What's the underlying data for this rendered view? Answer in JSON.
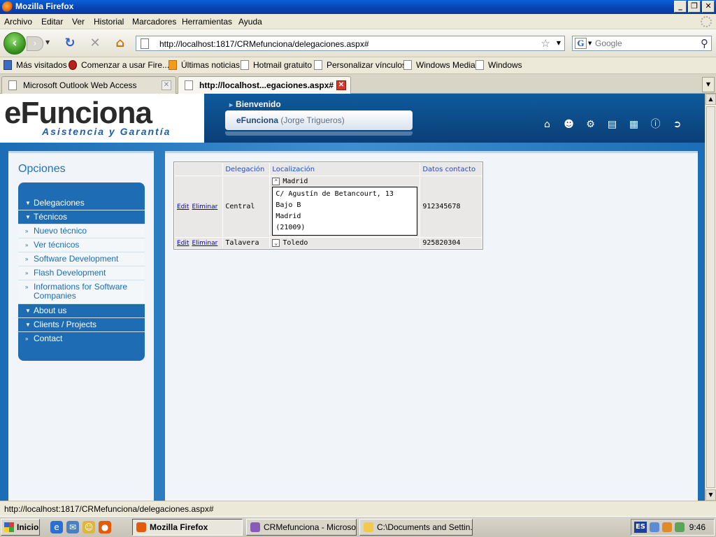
{
  "window": {
    "title": "Mozilla Firefox",
    "controls": [
      "_",
      "❐",
      "✕"
    ]
  },
  "menu": [
    "Archivo",
    "Editar",
    "Ver",
    "Historial",
    "Marcadores",
    "Herramientas",
    "Ayuda"
  ],
  "nav": {
    "url": "http://localhost:1817/CRMefunciona/delegaciones.aspx#",
    "search_placeholder": "Google"
  },
  "bookmarks": [
    "Más visitados",
    "Comenzar a usar Fire...",
    "Últimas noticias",
    "Hotmail gratuito",
    "Personalizar vínculos",
    "Windows Media",
    "Windows"
  ],
  "tabs": [
    {
      "label": "Microsoft Outlook Web Access",
      "active": false
    },
    {
      "label": "http://localhost...egaciones.aspx#",
      "active": true
    }
  ],
  "site": {
    "logo_main": "eFunciona",
    "logo_sub": "Asistencia y Garantía",
    "welcome": "Bienvenido",
    "user_name": "eFunciona",
    "user_detail": "(Jorge Trigueros)",
    "header_icons": [
      "home-icon",
      "user-icon",
      "settings-icon",
      "chart-icon",
      "table-icon",
      "help-icon",
      "exit-icon"
    ]
  },
  "sidebar": {
    "title": "Opciones",
    "items": [
      {
        "label": "Delegaciones",
        "type": "main"
      },
      {
        "label": "Técnicos",
        "type": "main"
      },
      {
        "label": "Nuevo técnico",
        "type": "sub"
      },
      {
        "label": "Ver técnicos",
        "type": "sub"
      },
      {
        "label": "Software Development",
        "type": "sub"
      },
      {
        "label": "Flash Development",
        "type": "sub"
      },
      {
        "label": "Informations for Software Companies",
        "type": "sub"
      },
      {
        "label": "About us",
        "type": "main"
      },
      {
        "label": "Clients / Projects",
        "type": "main"
      },
      {
        "label": "Contact",
        "type": "main"
      }
    ]
  },
  "grid": {
    "headers": [
      "",
      "Delegación",
      "Localización",
      "Datos contacto"
    ],
    "edit_label": "Edit",
    "delete_label": "Eliminar",
    "rows": [
      {
        "delegacion": "Central",
        "ciudad": "Madrid",
        "expanded": true,
        "direccion": "C/ Agustín de Betancourt, 13 Bajo B",
        "ciudad2": "Madrid",
        "cp": "(21009)",
        "telefono": "912345678"
      },
      {
        "delegacion": "Talavera",
        "ciudad": "Toledo",
        "expanded": false,
        "telefono": "925820304"
      }
    ]
  },
  "status": {
    "text": "http://localhost:1817/CRMefunciona/delegaciones.aspx#"
  },
  "taskbar": {
    "start": "Inicio",
    "items": [
      {
        "label": "Mozilla Firefox",
        "active": true
      },
      {
        "label": "CRMefunciona - Microsof...",
        "active": false
      },
      {
        "label": "C:\\Documents and Settin...",
        "active": false
      }
    ],
    "lang": "ES",
    "clock": "9:46"
  }
}
